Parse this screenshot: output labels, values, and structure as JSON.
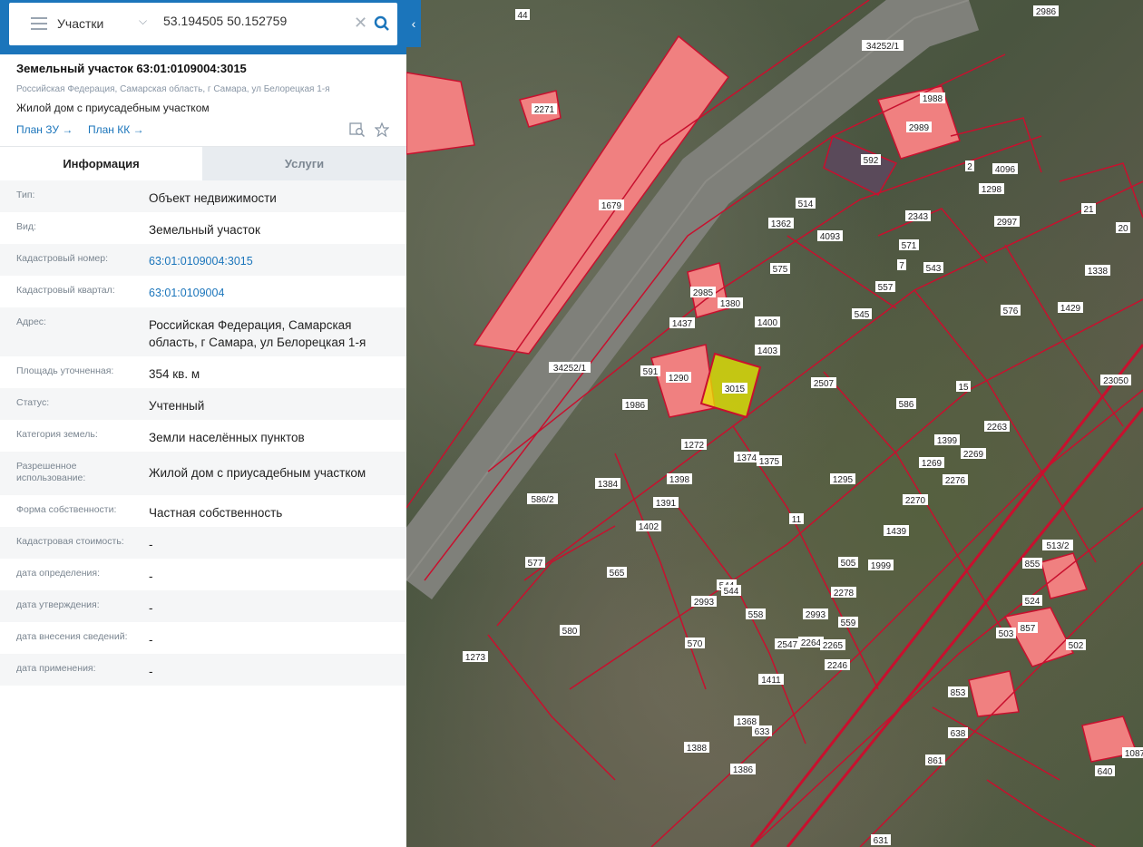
{
  "search": {
    "layer": "Участки",
    "query": "53.194505 50.152759"
  },
  "header": {
    "title": "Земельный участок 63:01:0109004:3015",
    "address": "Российская Федерация, Самарская область, г Самара, ул Белорецкая 1-я",
    "use": "Жилой дом с приусадебным участком",
    "plan_zu": "План ЗУ →",
    "plan_kk": "План КК →"
  },
  "tabs": {
    "info": "Информация",
    "services": "Услуги"
  },
  "info": [
    {
      "label": "Тип:",
      "value": "Объект недвижимости"
    },
    {
      "label": "Вид:",
      "value": "Земельный участок"
    },
    {
      "label": "Кадастровый номер:",
      "value": "63:01:0109004:3015"
    },
    {
      "label": "Кадастровый квартал:",
      "value": "63:01:0109004"
    },
    {
      "label": "Адрес:",
      "value": "Российская Федерация, Самарская область, г Самара, ул Белорецкая 1-я"
    },
    {
      "label": "Площадь уточненная:",
      "value": "354 кв. м"
    },
    {
      "label": "Статус:",
      "value": "Учтенный"
    },
    {
      "label": "Категория земель:",
      "value": "Земли населённых пунктов"
    },
    {
      "label": "Разрешенное использование:",
      "value": "Жилой дом с приусадебным участком"
    },
    {
      "label": "Форма собственности:",
      "value": "Частная собственность"
    },
    {
      "label": "Кадастровая стоимость:",
      "value": "-"
    },
    {
      "label": "дата определения:",
      "value": "-"
    },
    {
      "label": "дата утверждения:",
      "value": "-"
    },
    {
      "label": "дата внесения сведений:",
      "value": "-"
    },
    {
      "label": "дата применения:",
      "value": "-"
    }
  ],
  "map": {
    "parcel_labels": [
      "44",
      "2986",
      "34252/1",
      "2271",
      "1988",
      "2989",
      "1679",
      "592",
      "2",
      "4096",
      "1298",
      "2997",
      "21",
      "20",
      "514",
      "1362",
      "4093",
      "2343",
      "571",
      "7",
      "543",
      "575",
      "1338",
      "2985",
      "1380",
      "557",
      "576",
      "1429",
      "1437",
      "1400",
      "545",
      "34252/1",
      "1403",
      "23050",
      "591",
      "1290",
      "3015",
      "2507",
      "15",
      "586",
      "1986",
      "2263",
      "1399",
      "2269",
      "1269",
      "2276",
      "1272",
      "1374",
      "1375",
      "1398",
      "1295",
      "1384",
      "1391",
      "586/2",
      "1402",
      "11",
      "2270",
      "1439",
      "513/2",
      "855",
      "577",
      "565",
      "505",
      "1999",
      "524",
      "857",
      "544",
      "2278",
      "544",
      "559",
      "502",
      "2993",
      "558",
      "2993",
      "503",
      "580",
      "570",
      "1273",
      "2547",
      "2264",
      "2265",
      "2246",
      "1411",
      "853",
      "638",
      "1368",
      "633",
      "1388",
      "861",
      "1386",
      "640",
      "1087",
      "631"
    ],
    "colors": {
      "boundary": "#c8102e",
      "building": "#f08080",
      "selected": "#e8e800"
    }
  }
}
